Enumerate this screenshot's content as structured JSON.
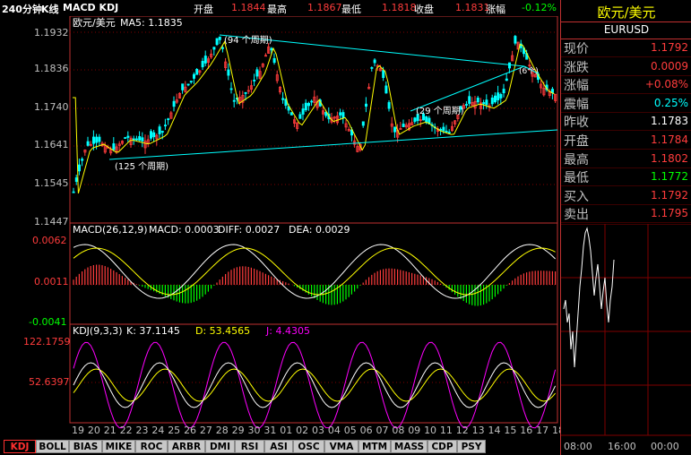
{
  "header": {
    "period_label": "240分钟",
    "type_label": "K线",
    "indicators_label": "MACD KDJ",
    "open_label": "开盘",
    "open_value": "1.1844",
    "high_label": "最高",
    "high_value": "1.1867",
    "low_label": "最低",
    "low_value": "1.1818",
    "close_label": "收盘",
    "close_value": "1.1831",
    "change_label": "涨幅",
    "change_value": "-0.12%"
  },
  "main_chart": {
    "symbol_label": "欧元/美元",
    "ma_label": "MA5: 1.1835",
    "y_ticks": [
      "1.1932",
      "1.1836",
      "1.1740",
      "1.1641",
      "1.1545",
      "1.1447"
    ],
    "annotations": [
      "(94 个周期)",
      "(125 个周期)",
      "(29 个周期)",
      "(6个)"
    ]
  },
  "macd": {
    "title": "MACD(26,12,9)",
    "macd_text": "MACD: 0.0003",
    "diff_text": "DIFF: 0.0027",
    "dea_text": "DEA: 0.0029",
    "y_ticks": [
      "0.0062",
      "0.0011",
      "-0.0041"
    ]
  },
  "kdj": {
    "title": "KDJ(9,3,3)",
    "k_text": "K: 37.1145",
    "d_text": "D: 53.4565",
    "j_text": "J: 4.4305",
    "y_ticks": [
      "122.1759",
      "52.6397"
    ]
  },
  "x_axis": {
    "labels": [
      "19",
      "20",
      "21",
      "22",
      "23",
      "24",
      "25",
      "26",
      "27",
      "28",
      "29",
      "30",
      "31",
      "01",
      "02",
      "03",
      "04",
      "05",
      "06",
      "07",
      "08",
      "09",
      "10",
      "11",
      "12",
      "13",
      "14",
      "15",
      "16",
      "17",
      "18"
    ]
  },
  "quote_panel": {
    "title": "欧元/美元",
    "code": "EURUSD",
    "rows": [
      {
        "label": "现价",
        "value": "1.1792",
        "color": "#ff3c3c"
      },
      {
        "label": "涨跌",
        "value": "0.0009",
        "color": "#ff3c3c"
      },
      {
        "label": "涨幅",
        "value": "+0.08%",
        "color": "#ff3c3c"
      },
      {
        "label": "震幅",
        "value": "0.25%",
        "color": "#00ffff"
      },
      {
        "label": "昨收",
        "value": "1.1783",
        "color": "#ffffff"
      },
      {
        "label": "开盘",
        "value": "1.1784",
        "color": "#ff3c3c"
      },
      {
        "label": "最高",
        "value": "1.1802",
        "color": "#ff3c3c"
      },
      {
        "label": "最低",
        "value": "1.1772",
        "color": "#00ff00"
      },
      {
        "label": "买入",
        "value": "1.1792",
        "color": "#ff3c3c"
      },
      {
        "label": "卖出",
        "value": "1.1795",
        "color": "#ff3c3c"
      }
    ],
    "time_labels": [
      "08:00",
      "16:00",
      "00:00"
    ]
  },
  "tabs": [
    "KDJ",
    "BOLL",
    "BIAS",
    "MIKE",
    "ROC",
    "ARBR",
    "DMI",
    "RSI",
    "ASI",
    "OSC",
    "VMA",
    "MTM",
    "MASS",
    "CDP",
    "PSY"
  ],
  "colors": {
    "up": "#ff3c3c",
    "down": "#00ffff",
    "ma": "#ffff00",
    "grid": "#800000",
    "macd_diff": "#ffffff",
    "macd_dea": "#ffff00",
    "kdj_k": "#ffffff",
    "kdj_d": "#ffff00",
    "kdj_j": "#ff00ff",
    "trend": "#00ffff"
  }
}
